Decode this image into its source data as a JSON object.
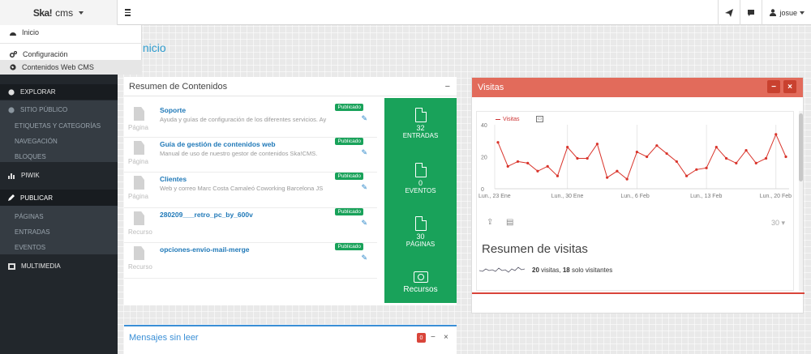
{
  "brand": {
    "logo": "Ska!",
    "label": "cms"
  },
  "topbar": {
    "user": "josue"
  },
  "dropdown": {
    "items": [
      {
        "label": "Inicio",
        "icon": "dashboard-icon"
      },
      {
        "label": "Configuración",
        "icon": "cogs-icon"
      },
      {
        "label": "Contenidos Web CMS",
        "icon": "globe-icon"
      }
    ]
  },
  "sidebar": {
    "explorar": "EXPLORAR",
    "sitio_publico": "SITIO PÚBLICO",
    "etiquetas": "ETIQUETAS Y CATEGORÍAS",
    "navegacion": "NAVEGACIÓN",
    "bloques": "BLOQUES",
    "piwik": "PIWIK",
    "publicar": "PUBLICAR",
    "paginas": "PÁGINAS",
    "entradas": "ENTRADAS",
    "eventos": "EVENTOS",
    "multimedia": "MULTIMEDIA"
  },
  "page_title": "Inicio",
  "content_panel": {
    "title": "Resumen de Contenidos",
    "items": [
      {
        "title": "Soporte",
        "desc": "Ayuda y guías de configuración de los diferentes servicios. Ay",
        "type": "Página",
        "status": "Publicado"
      },
      {
        "title": "Guía de gestión de contenidos web",
        "desc": "Manual de uso de nuestro gestor de contenidos Ska!CMS.",
        "type": "Página",
        "status": "Publicado"
      },
      {
        "title": "Clientes",
        "desc": "Web y correo Marc Costa Camaleó Coworking Barcelona JS",
        "type": "Página",
        "status": "Publicado"
      },
      {
        "title": "280209___retro_pc_by_600v",
        "desc": "",
        "type": "Recurso",
        "status": "Publicado"
      },
      {
        "title": "opciones-envio-mail-merge",
        "desc": "",
        "type": "Recurso",
        "status": "Publicado"
      }
    ],
    "stats": {
      "entradas_num": "32",
      "entradas_label": "ENTRADAS",
      "eventos_num": "0",
      "eventos_label": "EVENTOS",
      "paginas_num": "30",
      "paginas_label": "PÁGINAS",
      "recursos_label": "Recursos"
    }
  },
  "visits_panel": {
    "title": "Visitas",
    "legend": "Visitas",
    "summary_title": "Resumen de visitas",
    "visits_count": "20",
    "visits_text": " visitas, ",
    "unique_count": "18",
    "unique_text": " solo visitantes",
    "period": "30"
  },
  "chart_data": {
    "type": "line",
    "series": [
      {
        "name": "Visitas",
        "values": [
          29,
          14,
          17,
          16,
          11,
          14,
          8,
          26,
          19,
          19,
          28,
          7,
          11,
          6,
          23,
          20,
          27,
          22,
          17,
          8,
          12,
          13,
          26,
          19,
          16,
          24,
          16,
          19,
          34,
          20
        ]
      }
    ],
    "x_tick_labels": [
      "Lun., 23 Ene",
      "Lun., 30 Ene",
      "Lun., 6 Feb",
      "Lun., 13 Feb",
      "Lun., 20 Feb"
    ],
    "ylim": [
      0,
      40
    ],
    "y_ticks": [
      0,
      20,
      40
    ],
    "color": "#d9342b",
    "grid": "vertical"
  },
  "messages_panel": {
    "title": "Mensajes sin leer",
    "count": "0"
  }
}
